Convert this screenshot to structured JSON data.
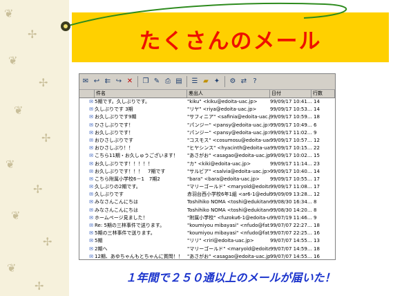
{
  "slide": {
    "title": "たくさんのメール",
    "caption": "１年間で２５０通以上のメールが届いた！"
  },
  "colors": {
    "title_band": "#ffd000",
    "title_text": "#ee1100",
    "caption_text": "#1a33cc"
  },
  "mail": {
    "columns": [
      "件名",
      "差出人",
      "日付",
      "行数"
    ],
    "rows": [
      {
        "subject": "5期です。久しぶりです。",
        "from": "\"kiku\" <kiku@edoita-uac.jp>",
        "date": "99/09/17 10:41...",
        "lines": "14"
      },
      {
        "subject": "久しぶりです 3期",
        "from": "\"リヤ\" <riya@edoita-uac.jp>",
        "date": "99/09/17 10:53...",
        "lines": "14"
      },
      {
        "subject": "お久しぶりです9期",
        "from": "\"サフィニア\" <safinia@edoita-uac.jp>",
        "date": "99/09/17 10:59...",
        "lines": "18"
      },
      {
        "subject": "ひさしぶりです！",
        "from": "\"パンジー\" <pansy@edoita-uac.jp>",
        "date": "99/09/17 10:49...",
        "lines": "6"
      },
      {
        "subject": "お久しぶりです！",
        "from": "\"パンジー\" <pansy@edoita-uac.jp>",
        "date": "99/09/17 11:02...",
        "lines": "9"
      },
      {
        "subject": "おひさしぶりです",
        "from": "\"コスモス\" <cosumosu@edoita-uac.jp>",
        "date": "99/09/17 10:57...",
        "lines": "12"
      },
      {
        "subject": "おひさしぶり！！",
        "from": "\"ヒヤシンス\" <hyacinth@edoita-uac.jp>",
        "date": "99/09/17 10:15...",
        "lines": "22"
      },
      {
        "subject": "こちら11期・お久しゅうございます！",
        "from": "\"あさがお\" <asagao@edoita-uac.jp>",
        "date": "99/09/17 10:02...",
        "lines": "15"
      },
      {
        "subject": "お久しぶりです！！！！！",
        "from": "\"カ\" <kiki@edoita-uac.jp>",
        "date": "99/09/17 11:14...",
        "lines": "23"
      },
      {
        "subject": "お久しぶりです！！！　7期です",
        "from": "\"サルビア\" <salvia@edoita-uac.jp>",
        "date": "99/09/17 10:40...",
        "lines": "14"
      },
      {
        "subject": "こちら附属小学校6－1　7期2",
        "from": "\"bara\" <bara@edoita-uac.jp>",
        "date": "99/09/17 10:55...",
        "lines": "17"
      },
      {
        "subject": "久しぶりの2期です。",
        "from": "\"マリーゴールド\" <maryold@edoita-u...",
        "date": "99/09/17 11:08...",
        "lines": "17"
      },
      {
        "subject": "久しぶりです",
        "from": "赤羽台西小学校6年1組 <ar6-1@eduk...",
        "date": "99/09/09 13:28...",
        "lines": "12"
      },
      {
        "subject": "みなさんこんにちは",
        "from": "Toshihiko NOMA <toshi@edukitanet...",
        "date": "99/08/30 16:34...",
        "lines": "8"
      },
      {
        "subject": "みなさんこんにちは",
        "from": "Toshihiko NOMA <toshi@edukitanet...",
        "date": "99/08/30 14:20...",
        "lines": "8"
      },
      {
        "subject": "ホームページ見ました！",
        "from": "\"附属小学校\" <fuzoku6-1@edoita-u-ja...",
        "date": "99/07/19 11:46...",
        "lines": "9"
      },
      {
        "subject": "Re: 5期の三林事件で送ります。",
        "from": "\"koumiyou mibayasi\" <nfudo@fat.coa...",
        "date": "99/07/07 22:27...",
        "lines": "18"
      },
      {
        "subject": "5期の三林事件で送ります。",
        "from": "\"koumiyou mibayasi\" <nfudo@fat.coa...",
        "date": "99/07/07 22:25...",
        "lines": "16"
      },
      {
        "subject": "5期",
        "from": "\"リリ\" <riri@edoita-uac.jp>",
        "date": "99/07/07 14:55...",
        "lines": "13"
      },
      {
        "subject": "2期へ",
        "from": "\"マリーゴールド\" <maryold@edoita-u...",
        "date": "99/07/07 14:59...",
        "lines": "18"
      },
      {
        "subject": "12期、あゆちゃんもとちゃんに質問！！",
        "from": "\"あさがお\" <asagao@edoita-uac.jp>",
        "date": "99/07/07 14:55...",
        "lines": "16"
      },
      {
        "subject": "1期へ",
        "from": "\"燕\" <yuu@edoita-uac.jp>",
        "date": "99/07/07 14:49...",
        "lines": "15"
      },
      {
        "subject": "11期だけど！教えろ(1)(11期です。教えて...",
        "from": "\"メロ\" <mero@edoita-uac.jp>",
        "date": "99/07/07 14:31...",
        "lines": "11"
      }
    ]
  }
}
